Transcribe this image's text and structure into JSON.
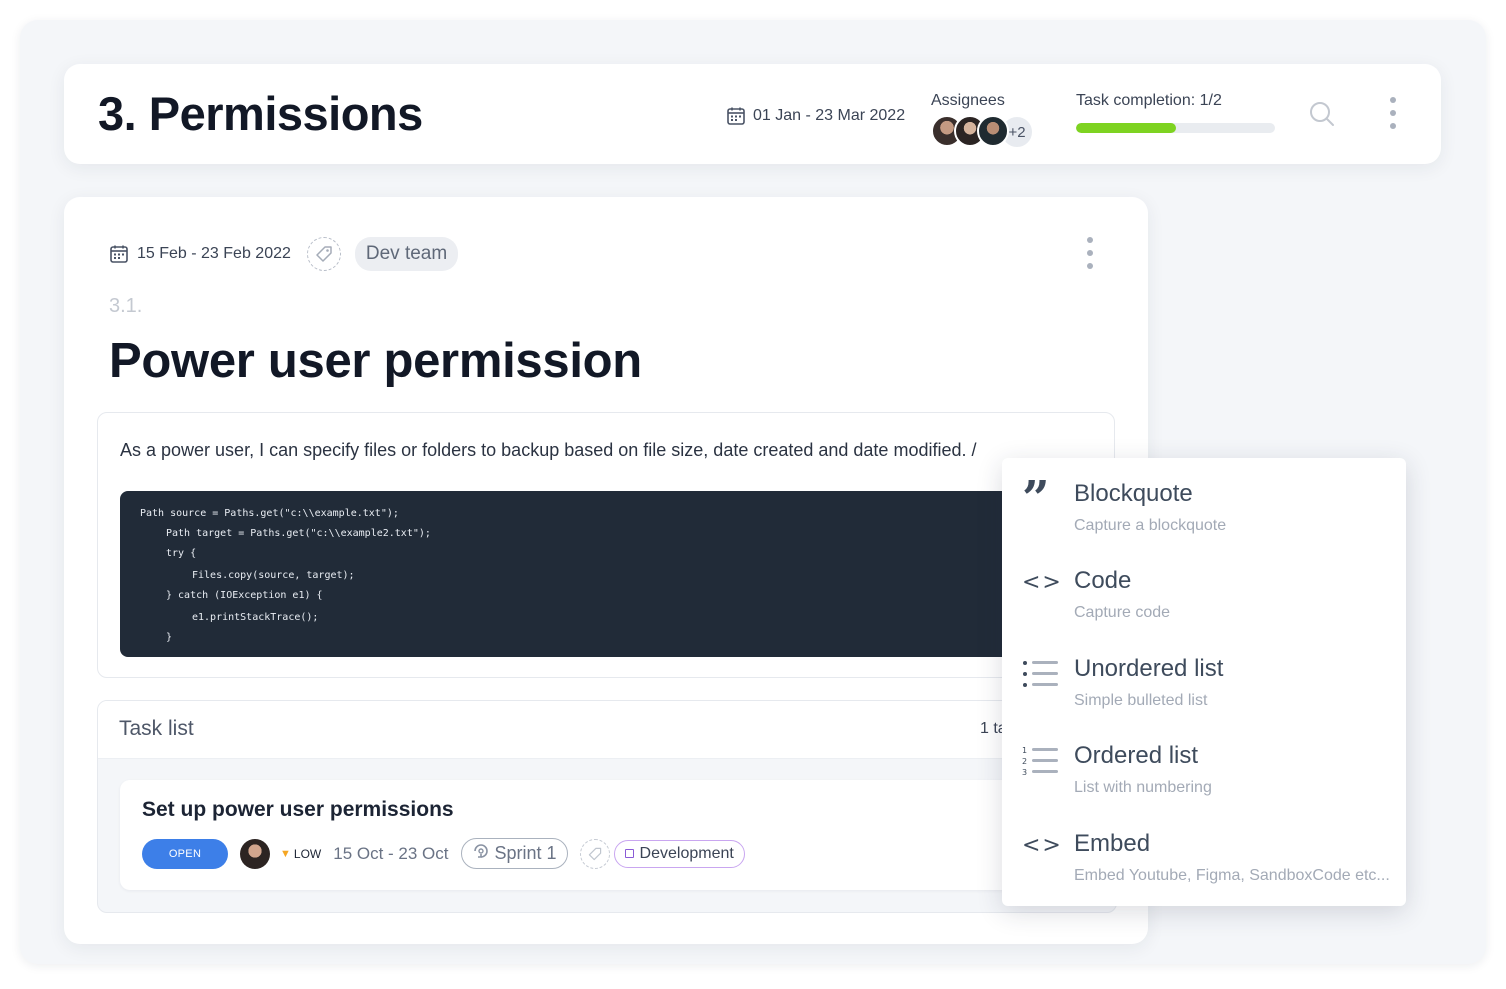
{
  "header": {
    "title": "3. Permissions",
    "date_range": "01 Jan - 23 Mar 2022",
    "assignees_label": "Assignees",
    "assignees_more": "+2",
    "completion_label": "Task completion: 1/2",
    "completion_fraction": 0.5,
    "completion_color": "#7ed321",
    "icons": [
      "calendar-icon",
      "search-icon",
      "more-vertical-icon"
    ]
  },
  "task": {
    "date_range": "15 Feb - 23 Feb 2022",
    "team": "Dev team",
    "number": "3.1.",
    "title": "Power user permission",
    "description": "As a power user, I can specify files or folders to backup based on file size, date created and date modified. /",
    "code_lines": [
      "Path source = Paths.get(\"c:\\\\example.txt\");",
      "Path target = Paths.get(\"c:\\\\example2.txt\");",
      "try {",
      "Files.copy(source, target);",
      "} catch (IOException e1) {",
      "e1.printStackTrace();",
      "}"
    ]
  },
  "tasklist": {
    "title": "Task list",
    "count": "1 ta",
    "items": [
      {
        "name": "Set up power user permissions",
        "status": "OPEN",
        "status_color": "#3d7fe8",
        "priority": "LOW",
        "priority_icon": "chevron-down-icon",
        "date_range": "15 Oct - 23 Oct",
        "sprint": "Sprint 1",
        "label": "Development"
      }
    ]
  },
  "slash_menu": {
    "items": [
      {
        "icon": "blockquote-icon",
        "label": "Blockquote",
        "description": "Capture a blockquote"
      },
      {
        "icon": "code-icon",
        "label": "Code",
        "description": "Capture code"
      },
      {
        "icon": "unordered-list-icon",
        "label": "Unordered list",
        "description": "Simple bulleted list"
      },
      {
        "icon": "ordered-list-icon",
        "label": "Ordered list",
        "description": "List with numbering"
      },
      {
        "icon": "embed-icon",
        "label": "Embed",
        "description": "Embed Youtube, Figma, SandboxCode etc..."
      }
    ]
  }
}
